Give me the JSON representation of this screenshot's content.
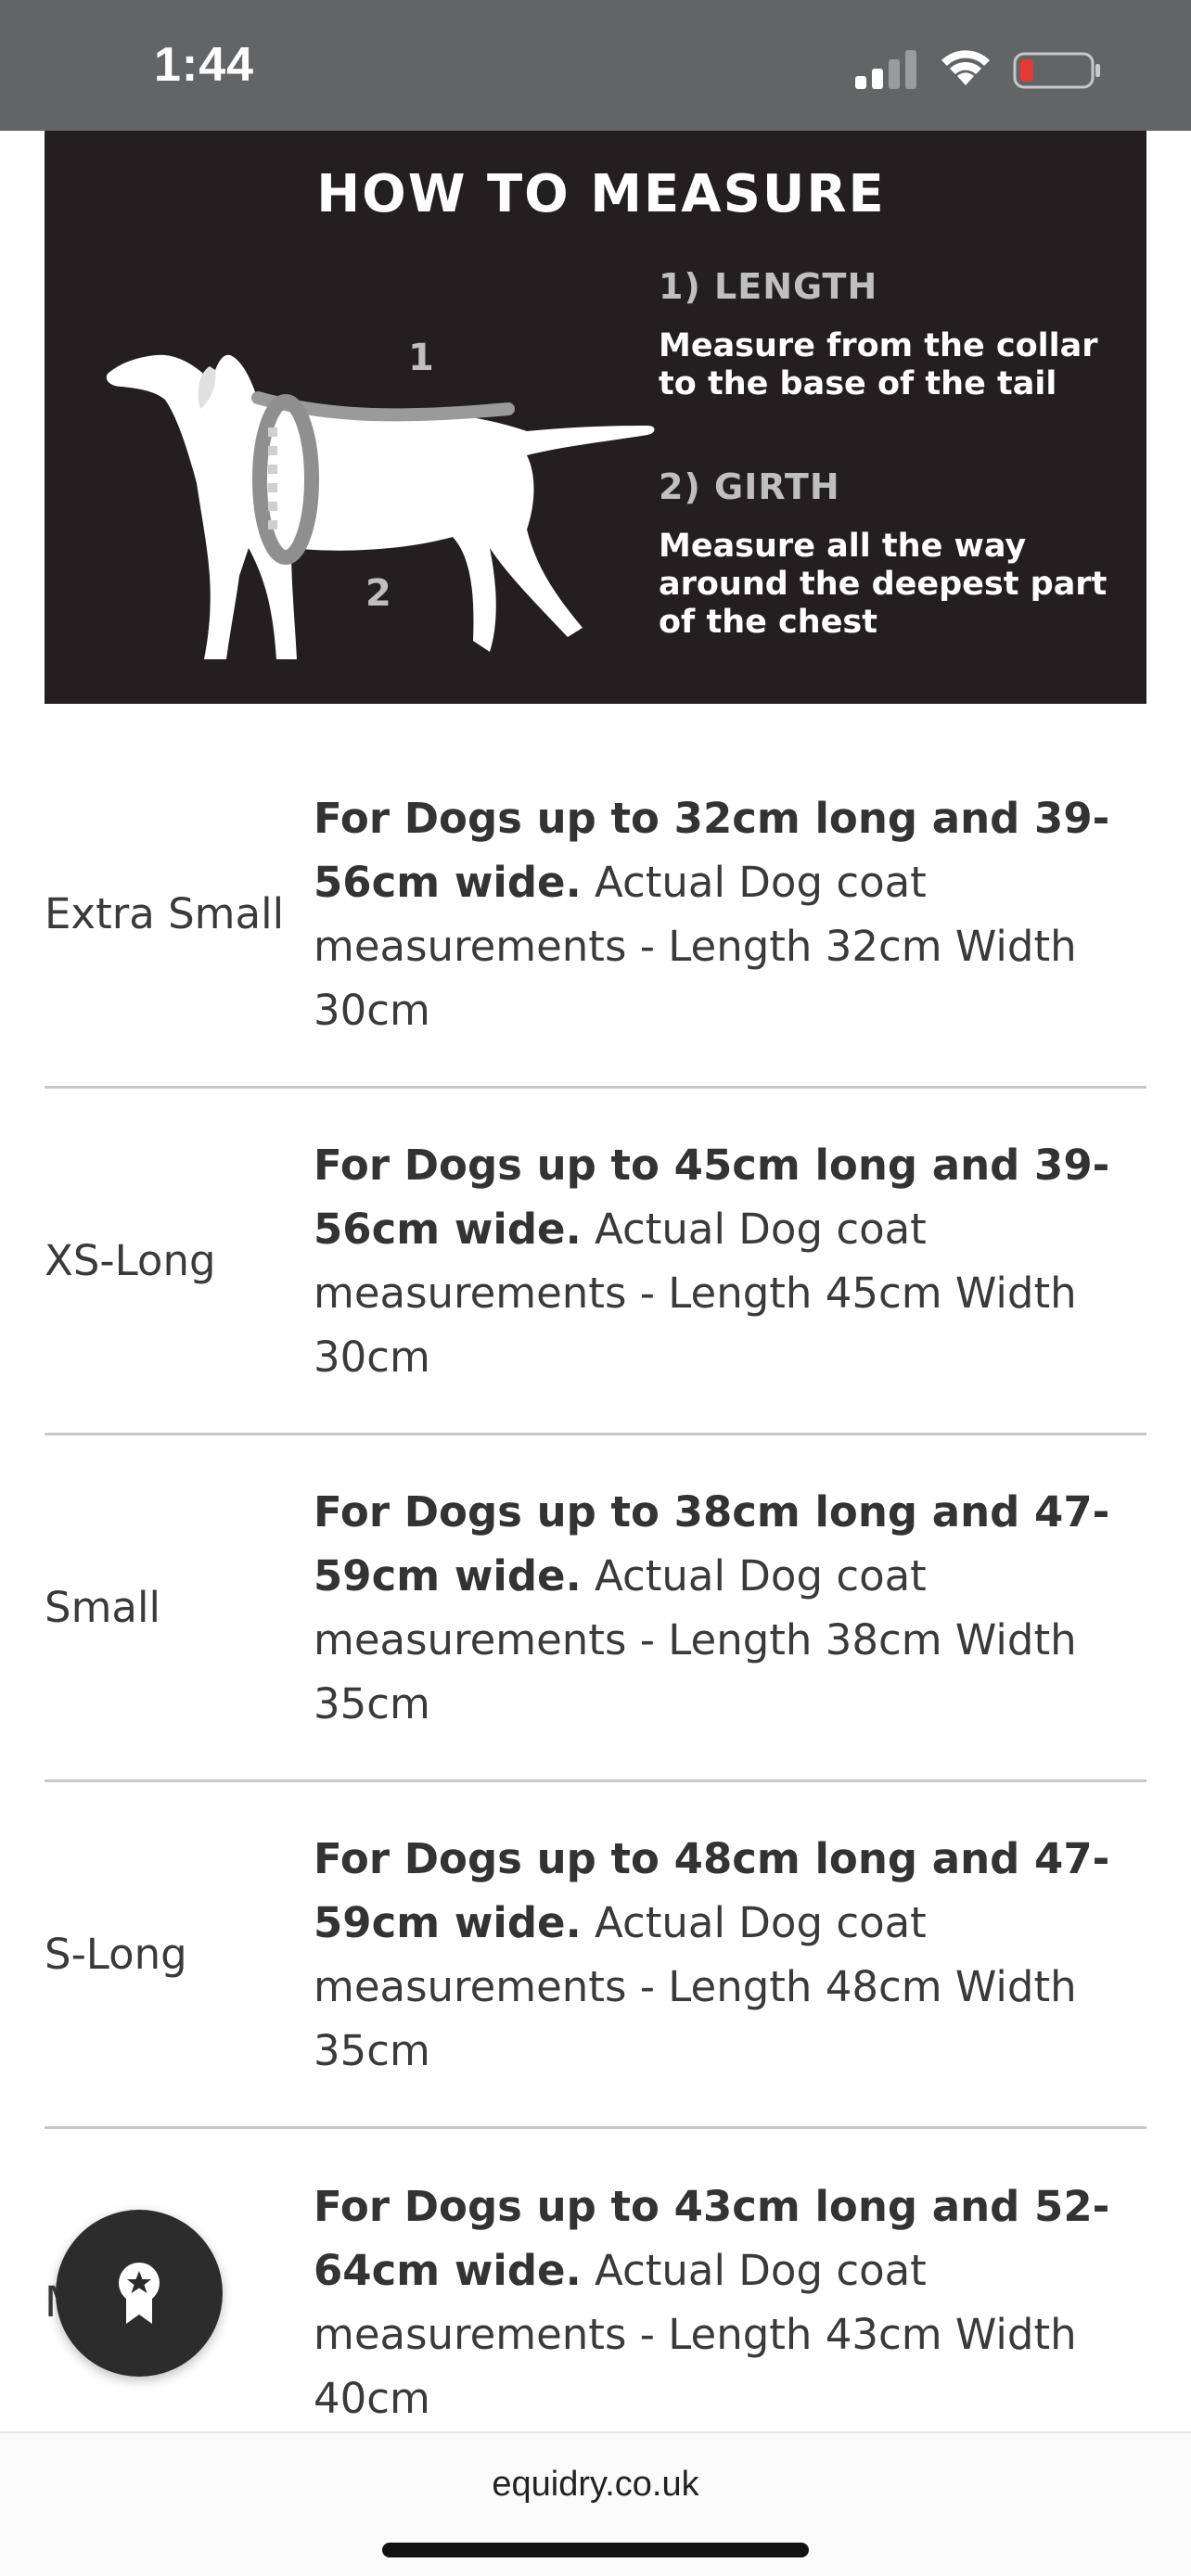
{
  "status_bar": {
    "time": "1:44",
    "signal_icon": "cellular-signal-icon",
    "wifi_icon": "wifi-icon",
    "battery_icon": "battery-low-icon",
    "battery_level": 0.12,
    "colors": {
      "background": "#636466",
      "battery_low": "#e53935"
    }
  },
  "measure_image": {
    "title": "HOW TO MEASURE",
    "marker_1": "1",
    "marker_2": "2",
    "length_heading": "1) LENGTH",
    "length_text": "Measure from the collar to the base of the tail",
    "girth_heading": "2) GIRTH",
    "girth_text": "Measure all the way around the deepest part of the chest",
    "colors": {
      "background": "#231f20"
    }
  },
  "size_rows": [
    {
      "name": "Extra Small",
      "bold": "For Dogs up to 32cm long and 39-56cm wide.",
      "detail": " Actual Dog coat measurements - Length 32cm Width 30cm"
    },
    {
      "name": "XS-Long",
      "bold": "For Dogs up to 45cm long and 39-56cm wide.",
      "detail": " Actual Dog coat measurements - Length 45cm Width 30cm"
    },
    {
      "name": "Small",
      "bold": "For Dogs up to 38cm long and 47-59cm wide.",
      "detail": " Actual Dog coat measurements - Length 38cm Width 35cm"
    },
    {
      "name": "S-Long",
      "bold": "For Dogs up to 48cm long and 47-59cm wide.",
      "detail": " Actual Dog coat measurements - Length 48cm Width 35cm"
    },
    {
      "name": "Medium",
      "bold": "For Dogs up to 43cm long and 52-64cm wide.",
      "detail": " Actual Dog coat measurements - Length 43cm Width 40cm"
    }
  ],
  "reward_button": {
    "icon": "ribbon-award-icon"
  },
  "browser_bar": {
    "url": "equidry.co.uk"
  }
}
